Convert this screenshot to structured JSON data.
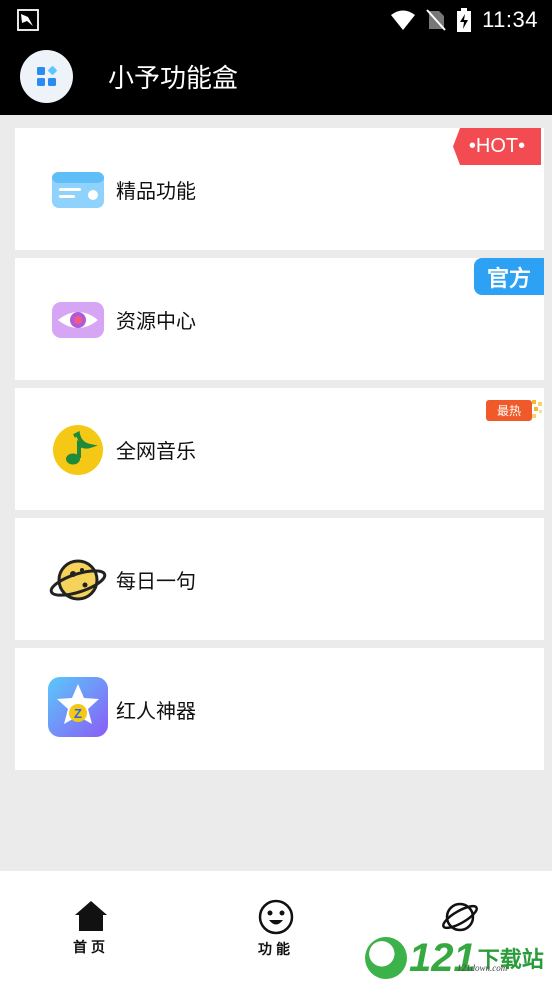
{
  "status_bar": {
    "time": "11:34",
    "icons": [
      "notification-icon",
      "wifi-icon",
      "no-sim-icon",
      "battery-icon"
    ]
  },
  "app_bar": {
    "title": "小予功能盒",
    "logo_icon": "app-logo-icon"
  },
  "cards": [
    {
      "label": "精品功能",
      "icon": "card-icon",
      "badge": "•HOT•"
    },
    {
      "label": "资源中心",
      "icon": "eye-icon",
      "badge": "官方"
    },
    {
      "label": "全网音乐",
      "icon": "music-note-icon",
      "badge": "最热"
    },
    {
      "label": "每日一句",
      "icon": "planet-icon",
      "badge": ""
    },
    {
      "label": "红人神器",
      "icon": "star-icon",
      "badge": ""
    }
  ],
  "bottom_nav": [
    {
      "label": "首页",
      "icon": "home-icon"
    },
    {
      "label": "功能",
      "icon": "smile-icon"
    },
    {
      "label": "",
      "icon": "planet-outline-icon"
    }
  ],
  "watermark": {
    "number": "121",
    "text": "下载站",
    "sub": "121down.com"
  },
  "colors": {
    "hot": "#f24c52",
    "official": "#2da1f3",
    "hottest": "#f05a2a",
    "app_bar": "#000000",
    "background": "#ebebeb"
  }
}
